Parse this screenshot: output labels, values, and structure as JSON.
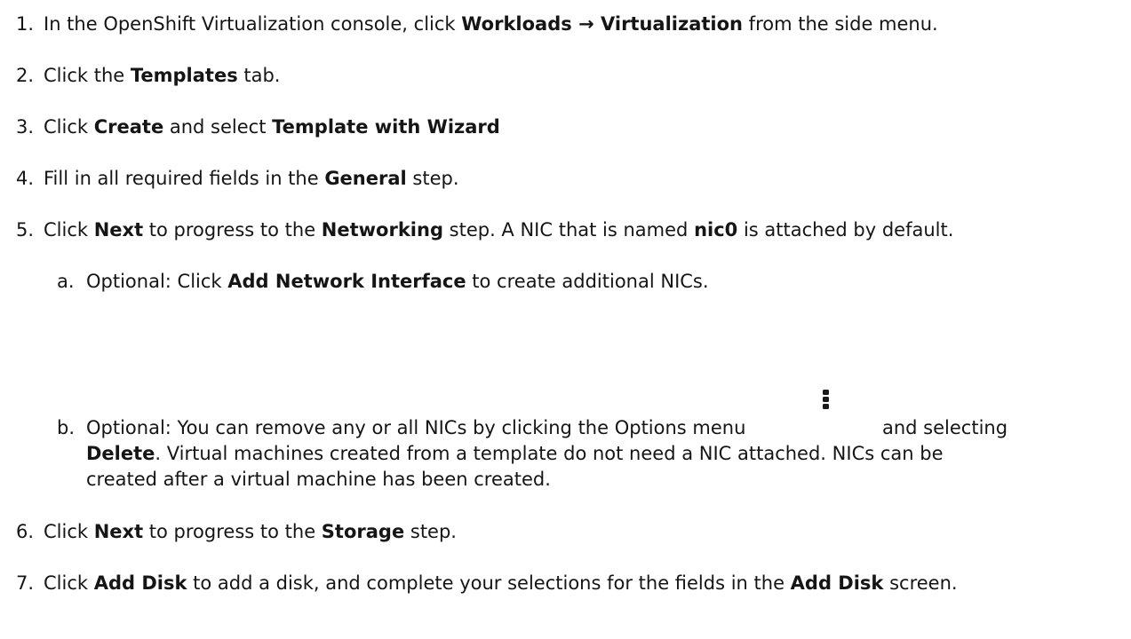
{
  "steps": [
    {
      "n": "1.",
      "parts": [
        "In the OpenShift Virtualization console, click ",
        "Workloads",
        " → ",
        "Virtualization",
        " from the side menu."
      ]
    },
    {
      "n": "2.",
      "parts": [
        "Click the ",
        "Templates",
        " tab."
      ]
    },
    {
      "n": "3.",
      "parts": [
        "Click ",
        "Create",
        " and select ",
        "Template with Wizard"
      ]
    },
    {
      "n": "4.",
      "parts": [
        "Fill in all required fields in the ",
        "General",
        " step."
      ]
    },
    {
      "n": "5.",
      "parts": [
        "Click ",
        "Next",
        " to progress to the ",
        "Networking",
        " step. A NIC that is named ",
        "nic0",
        " is attached by default."
      ]
    },
    {
      "n": "6.",
      "parts": [
        "Click ",
        "Next",
        " to progress to the ",
        "Storage",
        " step."
      ]
    },
    {
      "n": "7.",
      "parts": [
        "Click ",
        "Add Disk",
        " to add a disk, and complete your selections for the fields in the ",
        "Add Disk",
        " screen."
      ]
    }
  ],
  "substeps": [
    {
      "n": "a.",
      "parts": [
        "Optional: Click ",
        "Add Network Interface",
        " to create additional NICs."
      ]
    },
    {
      "n": "b.",
      "line1": [
        "Optional: You can remove any or all NICs by clicking the Options menu",
        "and selecting"
      ],
      "line2": [
        "Delete",
        ". Virtual machines created from a template do not need a NIC attached. NICs can be"
      ],
      "line3": "created after a virtual machine has been created."
    }
  ],
  "icons": {
    "options_menu": "kebab-icon"
  }
}
